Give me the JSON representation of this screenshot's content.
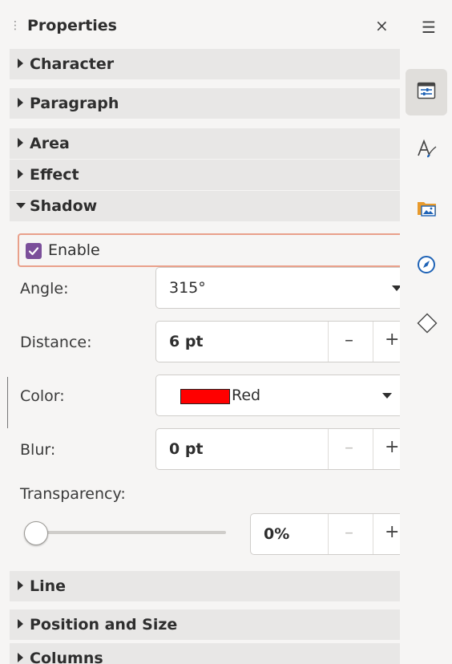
{
  "panel": {
    "title": "Properties",
    "close_glyph": "×",
    "grip_glyph": "⋮"
  },
  "sections": {
    "character": "Character",
    "paragraph": "Paragraph",
    "area": "Area",
    "effect": "Effect",
    "shadow": "Shadow",
    "line": "Line",
    "position_size": "Position and Size",
    "columns": "Columns"
  },
  "shadow": {
    "enable_label": "Enable",
    "enable_checked": true,
    "angle_label": "Angle:",
    "angle_value": "315°",
    "distance_label": "Distance:",
    "distance_value": "6 pt",
    "color_label": "Color:",
    "color_name": "Red",
    "color_hex": "#ff0000",
    "blur_label": "Blur:",
    "blur_value": "0 pt",
    "transparency_label": "Transparency:",
    "transparency_value": "0%",
    "transparency_level": 0,
    "minus_glyph": "–",
    "plus_glyph": "+"
  },
  "sidebar_tabs": {
    "menu_glyph": "☰",
    "items": [
      "properties-icon",
      "styles-icon",
      "gallery-icon",
      "navigator-icon",
      "shapes-icon"
    ],
    "active": "properties-icon"
  },
  "colors": {
    "accent_check": "#7b4f9a",
    "focus_border": "#e9a08a",
    "navigator_blue": "#1f63b6",
    "gallery_orange": "#e89a2c"
  }
}
